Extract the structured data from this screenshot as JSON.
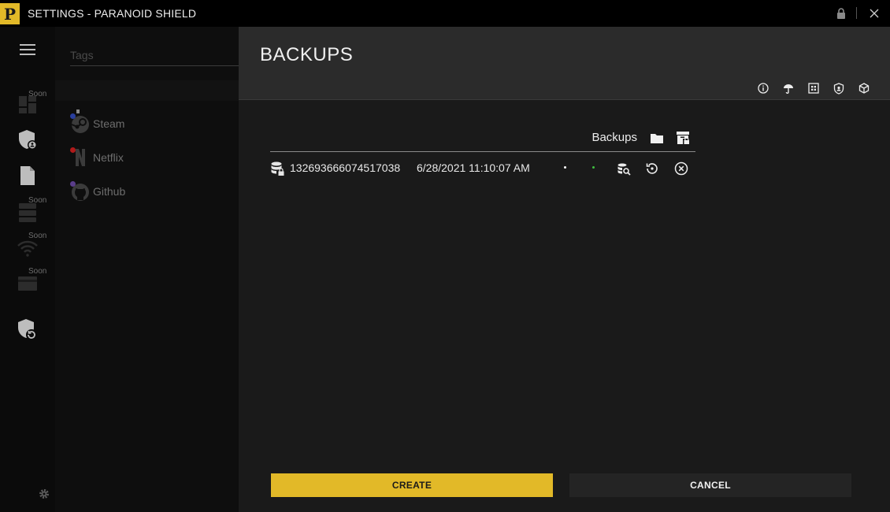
{
  "window": {
    "title": "SETTINGS - PARANOID SHIELD",
    "logo_letter": "P",
    "accent_color": "#e2b928",
    "controls": [
      "lock-icon",
      "close-icon"
    ]
  },
  "rail": {
    "items": [
      {
        "icon": "dashboard-icon",
        "soon": "Soon"
      },
      {
        "icon": "shield-user-icon",
        "soon": ""
      },
      {
        "icon": "document-icon",
        "soon": ""
      },
      {
        "icon": "server-icon",
        "soon": "Soon"
      },
      {
        "icon": "wifi-icon",
        "soon": "Soon"
      },
      {
        "icon": "card-icon",
        "soon": "Soon"
      },
      {
        "icon": "shield-refresh-icon",
        "soon": ""
      }
    ],
    "bottom_icon": "gear-icon"
  },
  "taglist": {
    "placeholder": "Tags",
    "items": [
      {
        "label": "Steam",
        "icon": "steam-icon",
        "dot_color": "#2a3f9e"
      },
      {
        "label": "Netflix",
        "icon": "netflix-icon",
        "dot_color": "#b01a1a"
      },
      {
        "label": "Github",
        "icon": "github-icon",
        "dot_color": "#5a3d8a"
      }
    ]
  },
  "settings": {
    "title": "BACKUPS",
    "header_icons": [
      "info-icon",
      "umbrella-icon",
      "qr-icon",
      "shield-badge-icon",
      "cube-icon"
    ],
    "section_label": "Backups",
    "section_icons": [
      "folder-icon",
      "archive-lock-icon"
    ],
    "backups": [
      {
        "id": "132693666074517038",
        "date": "6/28/2021 11:10:07 AM",
        "status_colors": [
          "#ffffff",
          "#3fbf3f"
        ]
      }
    ],
    "create_label": "CREATE",
    "cancel_label": "CANCEL"
  }
}
